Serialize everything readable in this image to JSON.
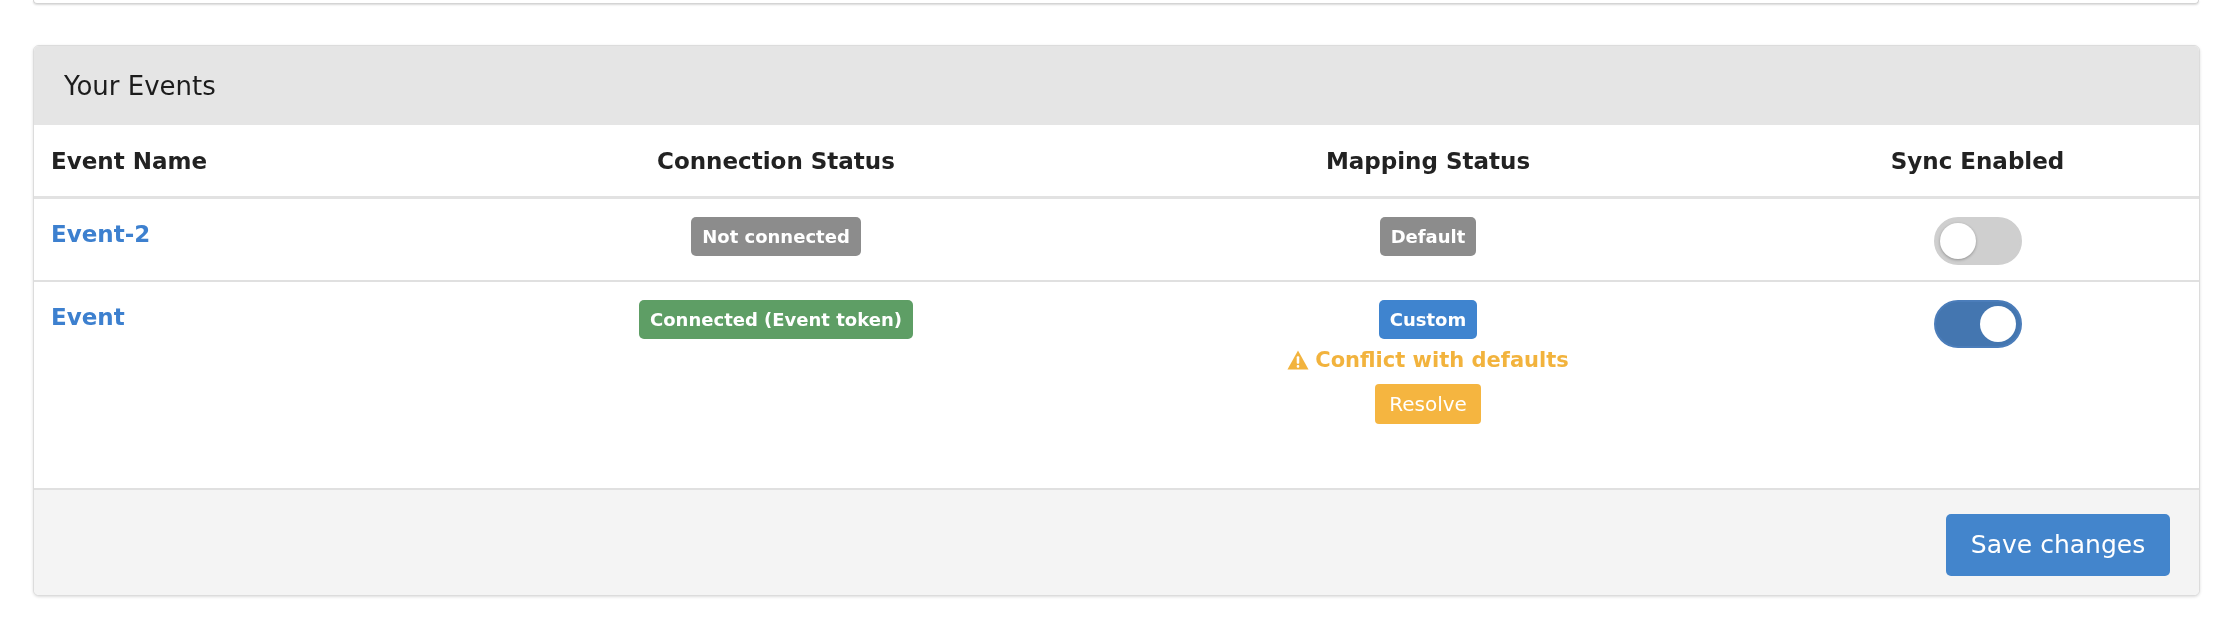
{
  "panel": {
    "title": "Your Events"
  },
  "table": {
    "columns": [
      "Event Name",
      "Connection Status",
      "Mapping Status",
      "Sync Enabled"
    ],
    "rows": [
      {
        "event_name": "Event-2",
        "connection": {
          "label": "Not connected",
          "kind": "neutral"
        },
        "mapping": {
          "label": "Default",
          "kind": "neutral"
        },
        "sync_enabled": false
      },
      {
        "event_name": "Event",
        "connection": {
          "label": "Connected (Event token)",
          "kind": "success"
        },
        "mapping": {
          "label": "Custom",
          "kind": "info",
          "warning": "Conflict with defaults",
          "action": "Resolve"
        },
        "sync_enabled": true
      }
    ]
  },
  "footer": {
    "buttons": [
      "Save changes"
    ]
  }
}
